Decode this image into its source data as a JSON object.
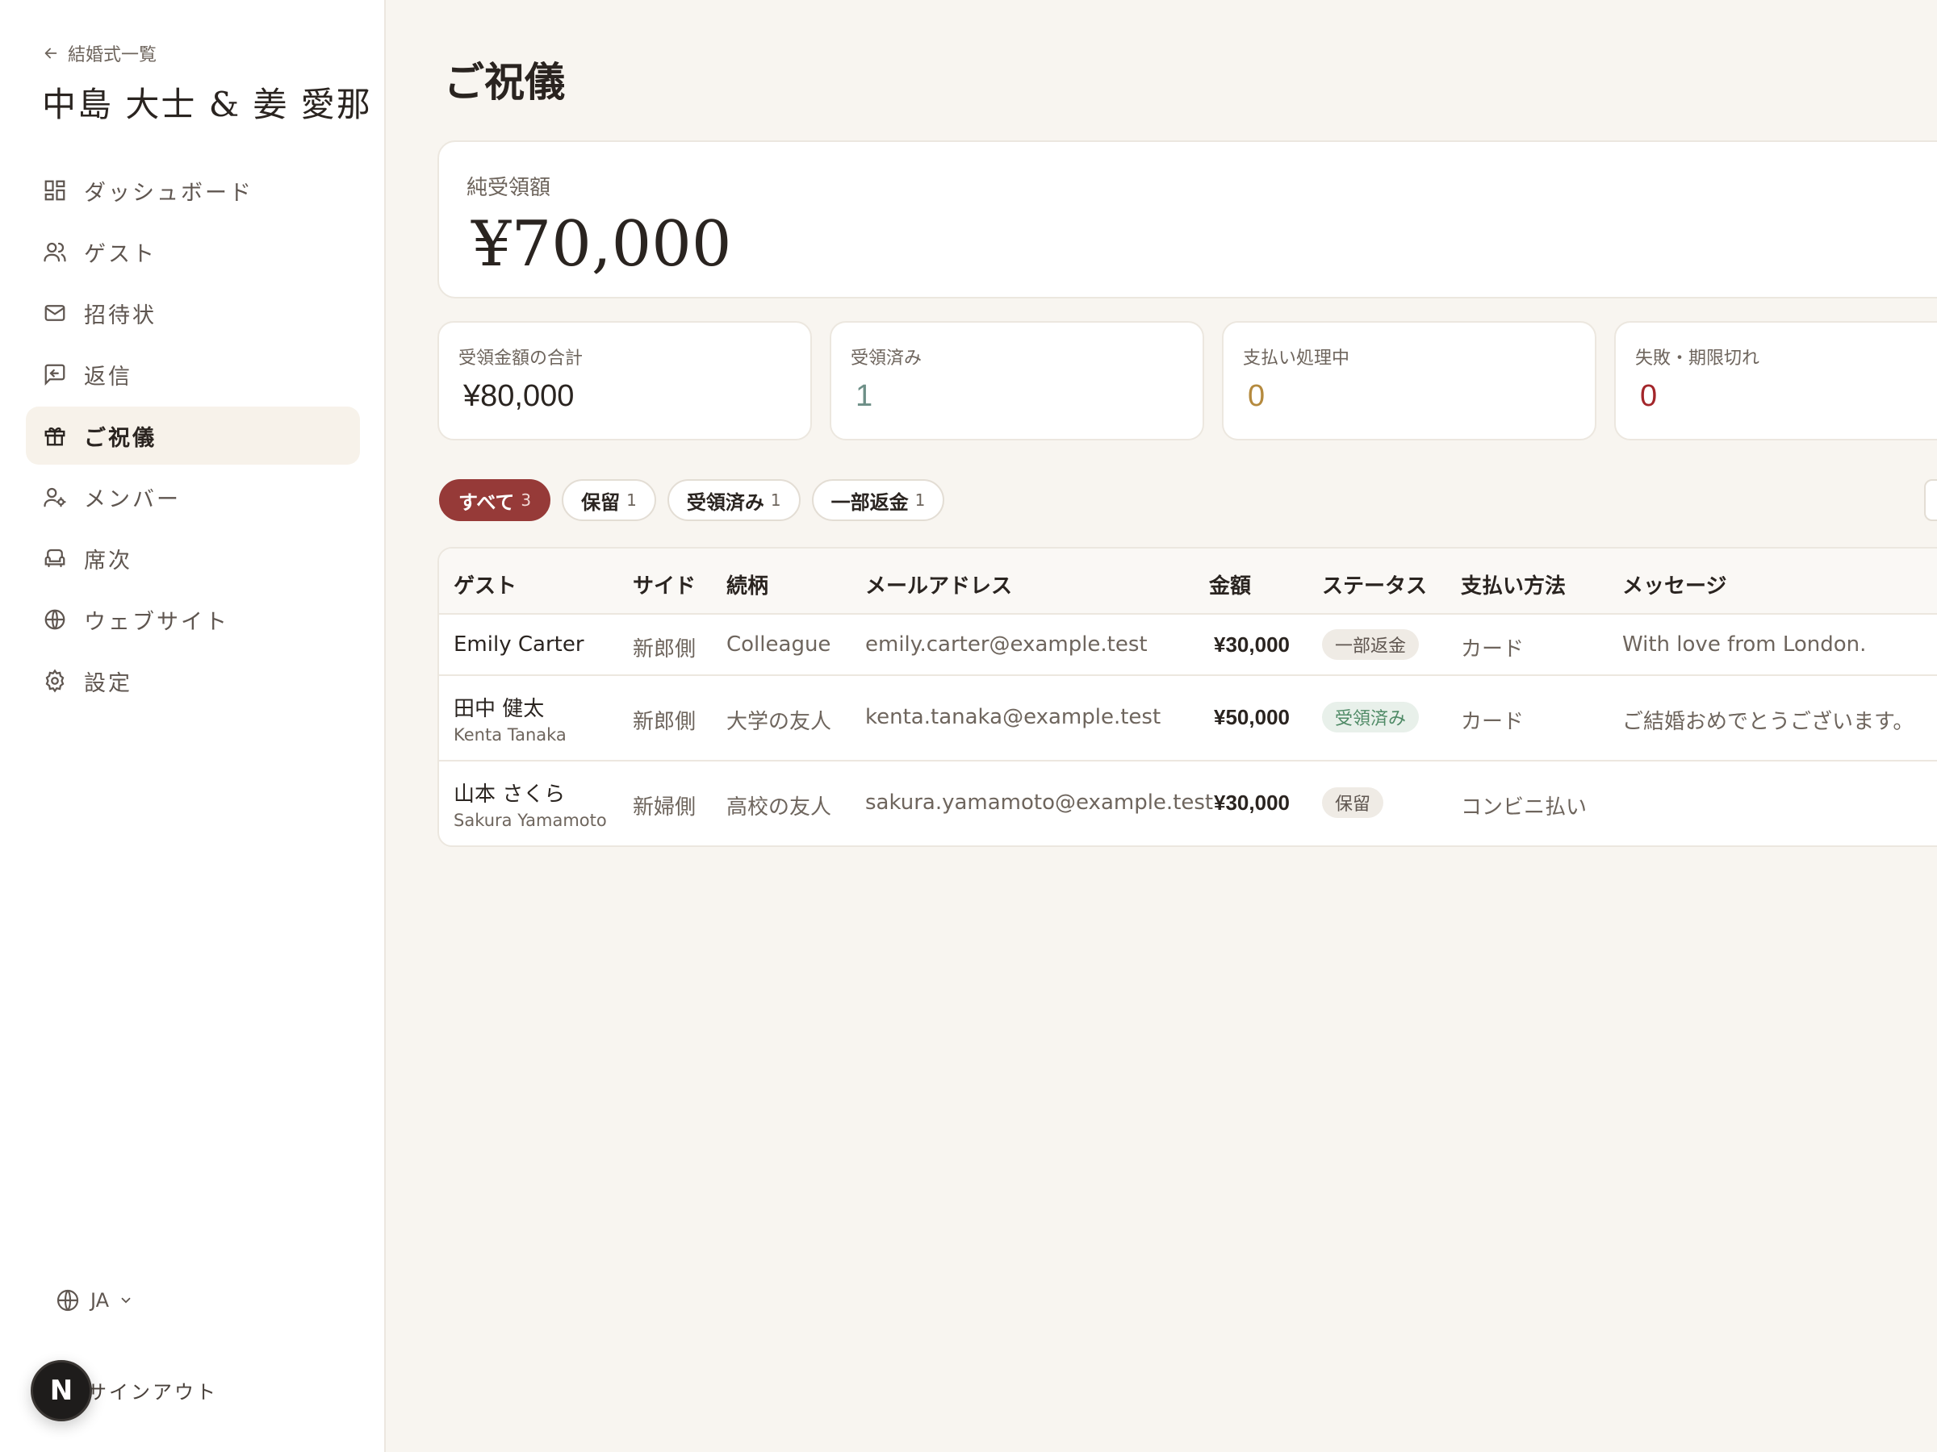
{
  "sidebar": {
    "back_label": "結婚式一覧",
    "couple_name": "中島 大士 & 姜 愛那",
    "items": [
      {
        "label": "ダッシュボード",
        "icon": "dashboard-icon"
      },
      {
        "label": "ゲスト",
        "icon": "users-icon"
      },
      {
        "label": "招待状",
        "icon": "mail-icon"
      },
      {
        "label": "返信",
        "icon": "reply-icon"
      },
      {
        "label": "ご祝儀",
        "icon": "gift-icon"
      },
      {
        "label": "メンバー",
        "icon": "user-cog-icon"
      },
      {
        "label": "席次",
        "icon": "seat-icon"
      },
      {
        "label": "ウェブサイト",
        "icon": "globe-icon"
      },
      {
        "label": "設定",
        "icon": "gear-icon"
      }
    ],
    "active_item": "ご祝儀",
    "language": "JA",
    "signout_label": "サインアウト",
    "avatar_letter": "N"
  },
  "main": {
    "title": "ご祝儀",
    "net": {
      "label": "純受領額",
      "value": "¥70,000"
    },
    "stats": [
      {
        "label": "受領金額の合計",
        "value": "¥80,000"
      },
      {
        "label": "受領済み",
        "value": "1"
      },
      {
        "label": "支払い処理中",
        "value": "0"
      },
      {
        "label": "失敗・期限切れ",
        "value": "0"
      }
    ],
    "filters": [
      {
        "label": "すべて",
        "count": "3"
      },
      {
        "label": "保留",
        "count": "1"
      },
      {
        "label": "受領済み",
        "count": "1"
      },
      {
        "label": "一部返金",
        "count": "1"
      }
    ],
    "table": {
      "headers": [
        "ゲスト",
        "サイド",
        "続柄",
        "メールアドレス",
        "金額",
        "ステータス",
        "支払い方法",
        "メッセージ"
      ],
      "rows": [
        {
          "name": "Emily Carter",
          "sub": "",
          "side": "新郎側",
          "relation": "Colleague",
          "email": "emily.carter@example.test",
          "amount": "¥30,000",
          "status": "一部返金",
          "method": "カード",
          "message": "With love from London."
        },
        {
          "name": "田中 健太",
          "sub": "Kenta Tanaka",
          "side": "新郎側",
          "relation": "大学の友人",
          "email": "kenta.tanaka@example.test",
          "amount": "¥50,000",
          "status": "受領済み",
          "method": "カード",
          "message": "ご結婚おめでとうございます。"
        },
        {
          "name": "山本 さくら",
          "sub": "Sakura Yamamoto",
          "side": "新婦側",
          "relation": "高校の友人",
          "email": "sakura.yamamoto@example.test",
          "amount": "¥30,000",
          "status": "保留",
          "method": "コンビニ払い",
          "message": ""
        }
      ]
    }
  },
  "colors": {
    "accent": "#963a38",
    "background": "#f8f5f0",
    "received": "#6d8f87",
    "processing": "#b58a3e",
    "failed": "#a3262a"
  }
}
